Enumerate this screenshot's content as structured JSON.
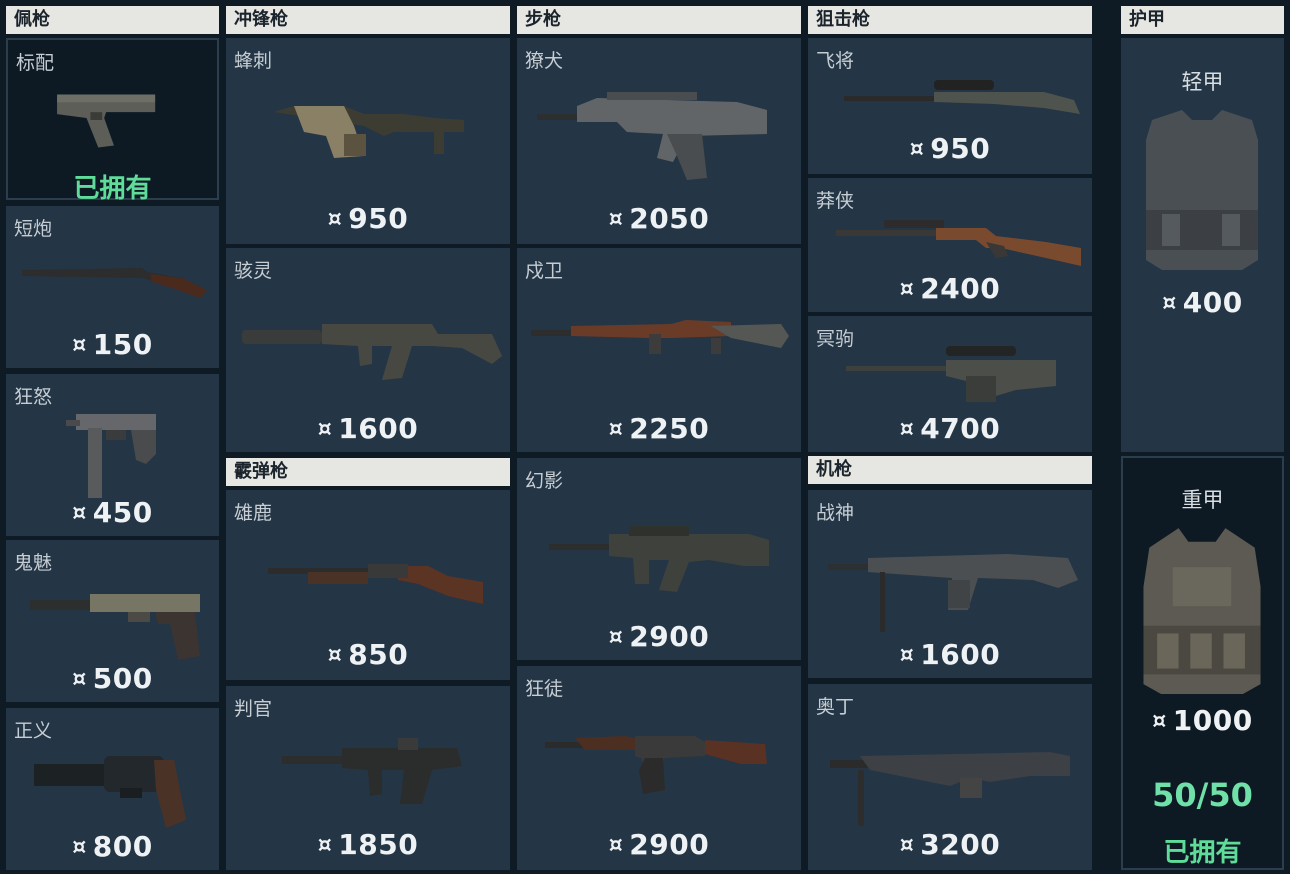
{
  "currency_icon": "¤",
  "colors": {
    "owned_text": "#5fdc9a",
    "card_bg": "#243545",
    "header_bg": "#e6e6e2"
  },
  "categories": {
    "pistols": "佩枪",
    "smg": "冲锋枪",
    "rifles": "步枪",
    "snipers": "狙击枪",
    "armor": "护甲",
    "shotguns": "霰弹枪",
    "mg": "机枪"
  },
  "pistols": [
    {
      "name": "标配",
      "status": "已拥有",
      "icon": "pistol-icon"
    },
    {
      "name": "短炮",
      "price": "150",
      "icon": "sawed-off-shotgun-icon"
    },
    {
      "name": "狂怒",
      "price": "450",
      "icon": "machine-pistol-icon"
    },
    {
      "name": "鬼魅",
      "price": "500",
      "icon": "suppressed-pistol-icon"
    },
    {
      "name": "正义",
      "price": "800",
      "icon": "revolver-icon"
    }
  ],
  "smg": [
    {
      "name": "蜂刺",
      "price": "950",
      "icon": "smg-icon"
    },
    {
      "name": "骇灵",
      "price": "1600",
      "icon": "suppressed-smg-icon"
    }
  ],
  "shotguns": [
    {
      "name": "雄鹿",
      "price": "850",
      "icon": "pump-shotgun-icon"
    },
    {
      "name": "判官",
      "price": "1850",
      "icon": "auto-shotgun-icon"
    }
  ],
  "rifles": [
    {
      "name": "獠犬",
      "price": "2050",
      "icon": "bullpup-rifle-icon"
    },
    {
      "name": "戍卫",
      "price": "2250",
      "icon": "marksman-rifle-icon"
    },
    {
      "name": "幻影",
      "price": "2900",
      "icon": "assault-rifle-icon"
    },
    {
      "name": "狂徒",
      "price": "2900",
      "icon": "ak-rifle-icon"
    }
  ],
  "snipers": [
    {
      "name": "飞将",
      "price": "950",
      "icon": "scout-sniper-icon"
    },
    {
      "name": "莽侠",
      "price": "2400",
      "icon": "lever-rifle-icon"
    },
    {
      "name": "冥驹",
      "price": "4700",
      "icon": "heavy-sniper-icon"
    }
  ],
  "mg": [
    {
      "name": "战神",
      "price": "1600",
      "icon": "lmg-icon"
    },
    {
      "name": "奥丁",
      "price": "3200",
      "icon": "heavy-mg-icon"
    }
  ],
  "armor": [
    {
      "name": "轻甲",
      "price": "400",
      "icon": "light-vest-icon"
    },
    {
      "name": "重甲",
      "price": "1000",
      "count": "50/50",
      "status": "已拥有",
      "icon": "heavy-vest-icon"
    }
  ]
}
